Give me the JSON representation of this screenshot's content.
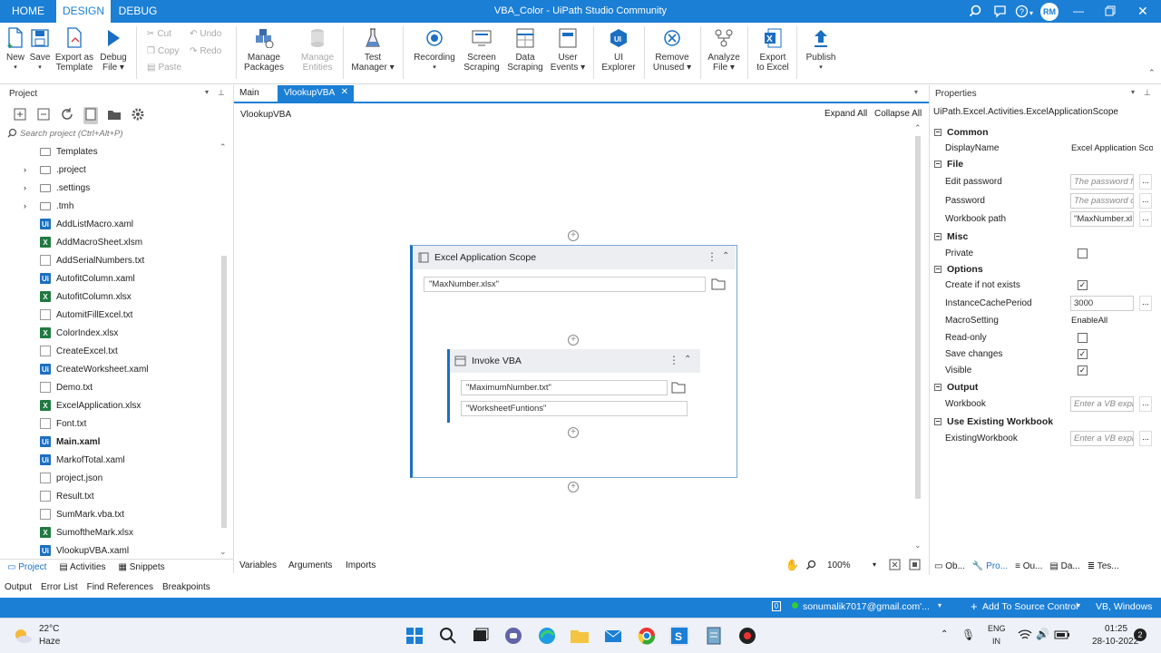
{
  "window": {
    "title": "VBA_Color - UiPath Studio Community",
    "avatar": "RM"
  },
  "title_tabs": [
    "HOME",
    "DESIGN",
    "DEBUG"
  ],
  "ribbon": {
    "new": "New",
    "save": "Save",
    "export_template_1": "Export as",
    "export_template_2": "Template",
    "debug_1": "Debug",
    "debug_2": "File",
    "cut": "Cut",
    "copy": "Copy",
    "paste": "Paste",
    "undo": "Undo",
    "redo": "Redo",
    "manage_packages_1": "Manage",
    "manage_packages_2": "Packages",
    "manage_entities_1": "Manage",
    "manage_entities_2": "Entities",
    "test_manager_1": "Test",
    "test_manager_2": "Manager",
    "recording": "Recording",
    "screen_scraping_1": "Screen",
    "screen_scraping_2": "Scraping",
    "data_scraping_1": "Data",
    "data_scraping_2": "Scraping",
    "user_events_1": "User",
    "user_events_2": "Events",
    "ui_explorer_1": "UI",
    "ui_explorer_2": "Explorer",
    "remove_unused_1": "Remove",
    "remove_unused_2": "Unused",
    "analyze_file_1": "Analyze",
    "analyze_file_2": "File",
    "export_excel_1": "Export",
    "export_excel_2": "to Excel",
    "publish": "Publish"
  },
  "project_panel": {
    "title": "Project",
    "search_placeholder": "Search project (Ctrl+Alt+P)",
    "items": [
      {
        "name": "Templates",
        "type": "folder",
        "expander": false
      },
      {
        "name": ".project",
        "type": "folder",
        "expander": true
      },
      {
        "name": ".settings",
        "type": "folder",
        "expander": true
      },
      {
        "name": ".tmh",
        "type": "folder",
        "expander": true
      },
      {
        "name": "AddListMacro.xaml",
        "type": "xaml"
      },
      {
        "name": "AddMacroSheet.xlsm",
        "type": "xlsx"
      },
      {
        "name": "AddSerialNumbers.txt",
        "type": "txt"
      },
      {
        "name": "AutofitColumn.xaml",
        "type": "xaml"
      },
      {
        "name": "AutofitColumn.xlsx",
        "type": "xlsx"
      },
      {
        "name": "AutomitFillExcel.txt",
        "type": "txt"
      },
      {
        "name": "ColorIndex.xlsx",
        "type": "xlsx"
      },
      {
        "name": "CreateExcel.txt",
        "type": "txt"
      },
      {
        "name": "CreateWorksheet.xaml",
        "type": "xaml"
      },
      {
        "name": "Demo.txt",
        "type": "txt"
      },
      {
        "name": "ExcelApplication.xlsx",
        "type": "xlsx"
      },
      {
        "name": "Font.txt",
        "type": "txt"
      },
      {
        "name": "Main.xaml",
        "type": "xaml",
        "bold": true
      },
      {
        "name": "MarkofTotal.xaml",
        "type": "xaml"
      },
      {
        "name": "project.json",
        "type": "txt"
      },
      {
        "name": "Result.txt",
        "type": "txt"
      },
      {
        "name": "SumMark.vba.txt",
        "type": "txt"
      },
      {
        "name": "SumoftheMark.xlsx",
        "type": "xlsx"
      },
      {
        "name": "VlookupVBA.xaml",
        "type": "xaml"
      }
    ],
    "bottom_tabs": [
      "Project",
      "Activities",
      "Snippets"
    ]
  },
  "output_tabs": [
    "Output",
    "Error List",
    "Find References",
    "Breakpoints"
  ],
  "designer": {
    "tabs": [
      "Main",
      "VlookupVBA"
    ],
    "breadcrumb": "VlookupVBA",
    "expand_all": "Expand All",
    "collapse_all": "Collapse All",
    "scope_title": "Excel Application Scope",
    "scope_path": "\"MaxNumber.xlsx\"",
    "invoke_title": "Invoke VBA",
    "invoke_file": "\"MaximumNumber.txt\"",
    "invoke_method": "\"WorksheetFuntions\"",
    "bottom_tabs": [
      "Variables",
      "Arguments",
      "Imports"
    ],
    "zoom": "100%"
  },
  "properties": {
    "title": "Properties",
    "type_name": "UiPath.Excel.Activities.ExcelApplicationScope",
    "categories": {
      "common": "Common",
      "file": "File",
      "misc": "Misc",
      "options": "Options",
      "output": "Output",
      "existing": "Use Existing Workbook"
    },
    "rows": {
      "display_name": {
        "label": "DisplayName",
        "value": "Excel Application Sco"
      },
      "edit_password": {
        "label": "Edit password",
        "value": "The password fo"
      },
      "password": {
        "label": "Password",
        "value": "The password o"
      },
      "workbook_path": {
        "label": "Workbook path",
        "value": "\"MaxNumber.xl"
      },
      "private": {
        "label": "Private"
      },
      "create_if_not_exists": {
        "label": "Create if not exists"
      },
      "instance_cache": {
        "label": "InstanceCachePeriod",
        "value": "3000"
      },
      "macro_setting": {
        "label": "MacroSetting",
        "value": "EnableAll"
      },
      "read_only": {
        "label": "Read-only"
      },
      "save_changes": {
        "label": "Save changes"
      },
      "visible": {
        "label": "Visible"
      },
      "workbook": {
        "label": "Workbook",
        "value": "Enter a VB expr"
      },
      "existing_workbook": {
        "label": "ExistingWorkbook",
        "value": "Enter a VB expr"
      }
    },
    "bottom_tabs": [
      "Ob...",
      "Pro...",
      "Ou...",
      "Da...",
      "Tes..."
    ]
  },
  "status": {
    "account": "sonumalik7017@gmail.com'...",
    "source_control": "Add To Source Control",
    "profile": "VB, Windows"
  },
  "taskbar": {
    "weather_temp": "22°C",
    "weather_desc": "Haze",
    "lang_1": "ENG",
    "lang_2": "IN",
    "time": "01:25",
    "date": "28-10-2022",
    "notif": "2"
  },
  "colors": {
    "accent": "#1b7fd6",
    "excel_green": "#1f7a3f"
  }
}
